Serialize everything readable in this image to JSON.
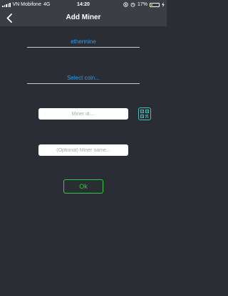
{
  "status_bar": {
    "carrier": "VN Mobifone",
    "network": "4G",
    "time": "14:20",
    "battery": "17%",
    "battery_level": 0.17
  },
  "nav": {
    "title": "Add Miner",
    "back_icon": "chevron-left-icon"
  },
  "form": {
    "pool_value": "ethermine",
    "coin_select_label": "Select coin...",
    "miner_id_placeholder": "Miner id....",
    "miner_name_placeholder": "(Optional) Miner name...",
    "qr_icon": "qr-code-icon",
    "ok_label": "Ok"
  },
  "colors": {
    "background": "#2a2d33",
    "bar": "#3b3e44",
    "link_blue": "#2f9bf0",
    "ok_green": "#2ecc40",
    "qr_teal": "#39c1b8"
  }
}
